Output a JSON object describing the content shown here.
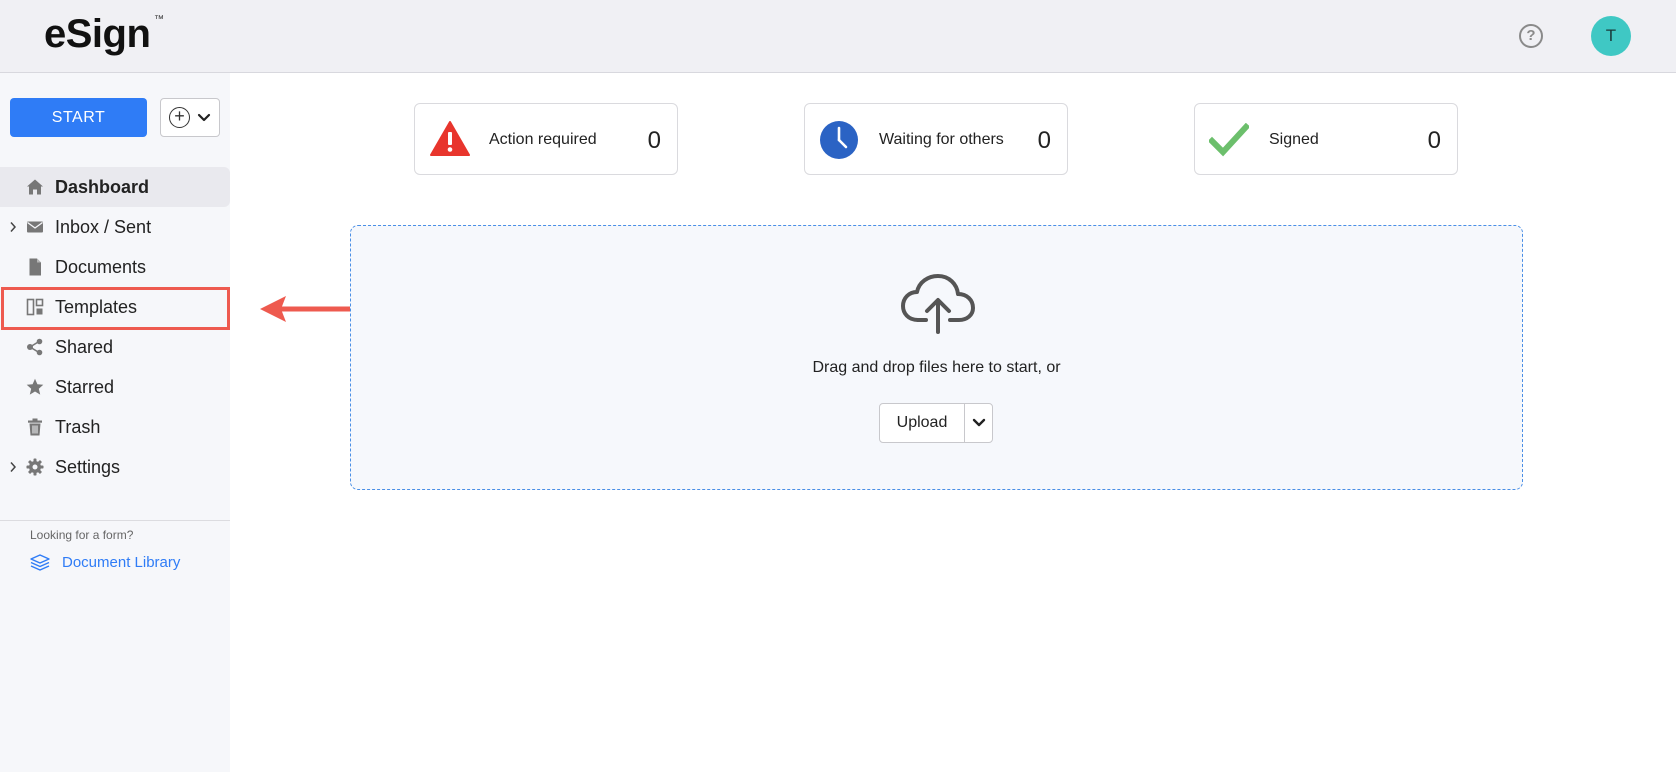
{
  "header": {
    "logo_text": "eSign",
    "logo_tm": "™",
    "help_glyph": "?",
    "avatar_initial": "T",
    "avatar_color": "#3fc8c4"
  },
  "sidebar": {
    "start_label": "START",
    "accent_color": "#2f7cf6",
    "add_glyph": "+",
    "items": [
      {
        "label": "Dashboard",
        "icon": "home-icon",
        "active": true,
        "expandable": false
      },
      {
        "label": "Inbox / Sent",
        "icon": "envelope-icon",
        "active": false,
        "expandable": true
      },
      {
        "label": "Documents",
        "icon": "document-icon",
        "active": false,
        "expandable": false
      },
      {
        "label": "Templates",
        "icon": "templates-icon",
        "active": false,
        "expandable": false,
        "highlighted": true
      },
      {
        "label": "Shared",
        "icon": "share-icon",
        "active": false,
        "expandable": false
      },
      {
        "label": "Starred",
        "icon": "star-icon",
        "active": false,
        "expandable": false
      },
      {
        "label": "Trash",
        "icon": "trash-icon",
        "active": false,
        "expandable": false
      },
      {
        "label": "Settings",
        "icon": "gear-icon",
        "active": false,
        "expandable": true
      }
    ],
    "form_hint": "Looking for a form?",
    "document_library_label": "Document Library"
  },
  "stats": [
    {
      "label": "Action required",
      "count": "0",
      "icon": "warning-icon",
      "color": "#e8352d"
    },
    {
      "label": "Waiting for others",
      "count": "0",
      "icon": "clock-icon",
      "color": "#2b63c4"
    },
    {
      "label": "Signed",
      "count": "0",
      "icon": "checkmark-icon",
      "color": "#6cbf6c"
    }
  ],
  "dropzone": {
    "text": "Drag and drop files here to start, or",
    "upload_label": "Upload",
    "icon": "cloud-upload-icon"
  },
  "annotation": {
    "highlight_color": "#ee5a4f"
  }
}
